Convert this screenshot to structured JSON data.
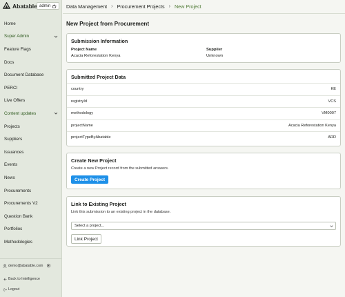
{
  "brand": {
    "name": "Abatable",
    "env_label": "admin"
  },
  "sidebar": {
    "items": [
      {
        "label": "Home"
      },
      {
        "label": "Super Admin",
        "expandable": true
      },
      {
        "label": "Feature Flags"
      },
      {
        "label": "Docs"
      },
      {
        "label": "Document Database"
      },
      {
        "label": "PERCI"
      },
      {
        "label": "Live Offers"
      },
      {
        "label": "Content updates",
        "expandable": true
      },
      {
        "label": "Projects"
      },
      {
        "label": "Suppliers"
      },
      {
        "label": "Issuances"
      },
      {
        "label": "Events"
      },
      {
        "label": "News"
      },
      {
        "label": "Procurements"
      },
      {
        "label": "Procurements V2"
      },
      {
        "label": "Question Bank"
      },
      {
        "label": "Portfolios"
      },
      {
        "label": "Methodologies"
      }
    ],
    "user_email": "demo@abatable.com",
    "back_label": "Back to Intelligence",
    "logout_label": "Logout"
  },
  "breadcrumb": [
    "Data Management",
    "Procurement Projects",
    "New Project"
  ],
  "page_title": "New Project from Procurement",
  "submission_info": {
    "title": "Submission Information",
    "project_name_label": "Project Name",
    "project_name_value": "Acacia Reforestation Kenya",
    "supplier_label": "Supplier",
    "supplier_value": "Unknown"
  },
  "submitted_data": {
    "title": "Submitted Project Data",
    "rows": [
      {
        "key": "country",
        "value": "KE"
      },
      {
        "key": "registryId",
        "value": "VCS"
      },
      {
        "key": "methodology",
        "value": "VM0007"
      },
      {
        "key": "projectName",
        "value": "Acacia Reforestation Kenya"
      },
      {
        "key": "projectTypeByAbatable",
        "value": "ARR"
      }
    ]
  },
  "create_section": {
    "title": "Create New Project",
    "description": "Create a new Project record from the submitted answers.",
    "button_label": "Create Project"
  },
  "link_section": {
    "title": "Link to Existing Project",
    "description": "Link this submission to an existing project in the database.",
    "select_placeholder": "Select a project...",
    "button_label": "Link Project"
  },
  "colors": {
    "primary": "#1e90e8",
    "sidebar_bg": "#e3e8de",
    "breadcrumb_current": "#4f7a35"
  }
}
